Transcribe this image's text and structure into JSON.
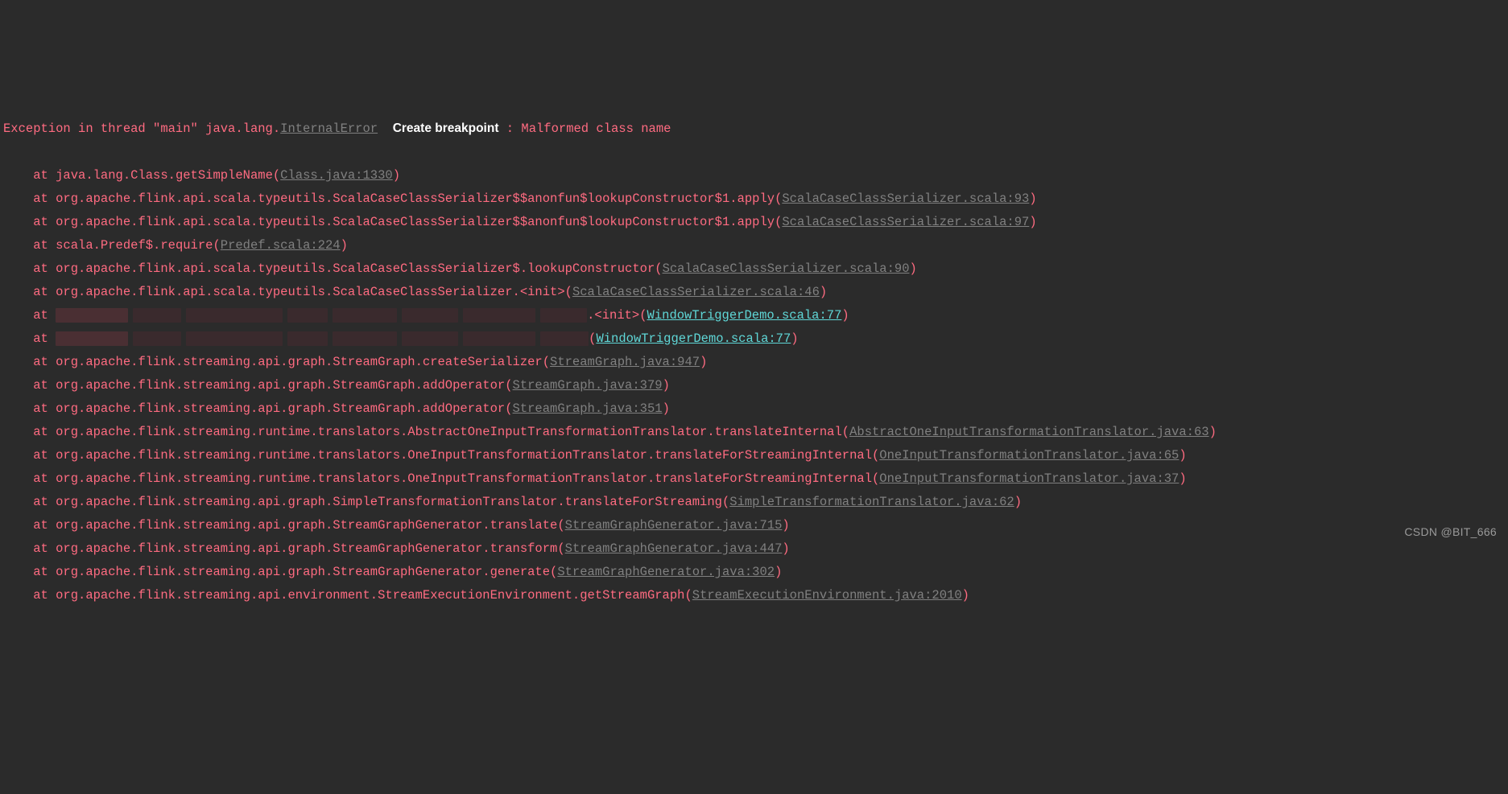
{
  "exception": {
    "prefix": "Exception in thread \"main\" java.lang.",
    "error_class": "InternalError",
    "create_breakpoint": "Create breakpoint",
    "message_suffix": " : Malformed class name"
  },
  "lines": [
    {
      "at": "    at ",
      "text": "java.lang.Class.getSimpleName(",
      "link": "Class.java:1330",
      "link_style": "gray",
      "close": ")"
    },
    {
      "at": "    at ",
      "text": "org.apache.flink.api.scala.typeutils.ScalaCaseClassSerializer$$anonfun$lookupConstructor$1.apply(",
      "link": "ScalaCaseClassSerializer.scala:93",
      "link_style": "gray",
      "close": ")"
    },
    {
      "at": "    at ",
      "text": "org.apache.flink.api.scala.typeutils.ScalaCaseClassSerializer$$anonfun$lookupConstructor$1.apply(",
      "link": "ScalaCaseClassSerializer.scala:97",
      "link_style": "gray",
      "close": ")"
    },
    {
      "at": "    at ",
      "text": "scala.Predef$.require(",
      "link": "Predef.scala:224",
      "link_style": "gray",
      "close": ")"
    },
    {
      "at": "    at ",
      "text": "org.apache.flink.api.scala.typeutils.ScalaCaseClassSerializer$.lookupConstructor(",
      "link": "ScalaCaseClassSerializer.scala:90",
      "link_style": "gray",
      "close": ")"
    },
    {
      "at": "    at ",
      "text": "org.apache.flink.api.scala.typeutils.ScalaCaseClassSerializer.<init>(",
      "link": "ScalaCaseClassSerializer.scala:46",
      "link_style": "gray",
      "close": ")"
    },
    {
      "at": "    at ",
      "redacted": true,
      "redact_width_total": 660,
      "tail": ".<init>(",
      "link": "WindowTriggerDemo.scala:77",
      "link_style": "cyan",
      "close": ")"
    },
    {
      "at": "    at ",
      "redacted": true,
      "redact_width_total": 730,
      "tail": "(",
      "link": "WindowTriggerDemo.scala:77",
      "link_style": "cyan",
      "close": ")"
    },
    {
      "at": "    at ",
      "text": "org.apache.flink.streaming.api.graph.StreamGraph.createSerializer(",
      "link": "StreamGraph.java:947",
      "link_style": "gray",
      "close": ")"
    },
    {
      "at": "    at ",
      "text": "org.apache.flink.streaming.api.graph.StreamGraph.addOperator(",
      "link": "StreamGraph.java:379",
      "link_style": "gray",
      "close": ")"
    },
    {
      "at": "    at ",
      "text": "org.apache.flink.streaming.api.graph.StreamGraph.addOperator(",
      "link": "StreamGraph.java:351",
      "link_style": "gray",
      "close": ")"
    },
    {
      "at": "    at ",
      "text": "org.apache.flink.streaming.runtime.translators.AbstractOneInputTransformationTranslator.translateInternal(",
      "link": "AbstractOneInputTransformationTranslator.java:63",
      "link_style": "gray",
      "close": ")"
    },
    {
      "at": "    at ",
      "text": "org.apache.flink.streaming.runtime.translators.OneInputTransformationTranslator.translateForStreamingInternal(",
      "link": "OneInputTransformationTranslator.java:65",
      "link_style": "gray",
      "close": ")"
    },
    {
      "at": "    at ",
      "text": "org.apache.flink.streaming.runtime.translators.OneInputTransformationTranslator.translateForStreamingInternal(",
      "link": "OneInputTransformationTranslator.java:37",
      "link_style": "gray",
      "close": ")"
    },
    {
      "at": "    at ",
      "text": "org.apache.flink.streaming.api.graph.SimpleTransformationTranslator.translateForStreaming(",
      "link": "SimpleTransformationTranslator.java:62",
      "link_style": "gray",
      "close": ")"
    },
    {
      "at": "    at ",
      "text": "org.apache.flink.streaming.api.graph.StreamGraphGenerator.translate(",
      "link": "StreamGraphGenerator.java:715",
      "link_style": "gray",
      "close": ")"
    },
    {
      "at": "    at ",
      "text": "org.apache.flink.streaming.api.graph.StreamGraphGenerator.transform(",
      "link": "StreamGraphGenerator.java:447",
      "link_style": "gray",
      "close": ")"
    },
    {
      "at": "    at ",
      "text": "org.apache.flink.streaming.api.graph.StreamGraphGenerator.generate(",
      "link": "StreamGraphGenerator.java:302",
      "link_style": "gray",
      "close": ")"
    },
    {
      "at": "    at ",
      "text": "org.apache.flink.streaming.api.environment.StreamExecutionEnvironment.getStreamGraph(",
      "link": "StreamExecutionEnvironment.java:2010",
      "link_style": "gray",
      "close": ")"
    }
  ],
  "watermark": "CSDN @BIT_666"
}
